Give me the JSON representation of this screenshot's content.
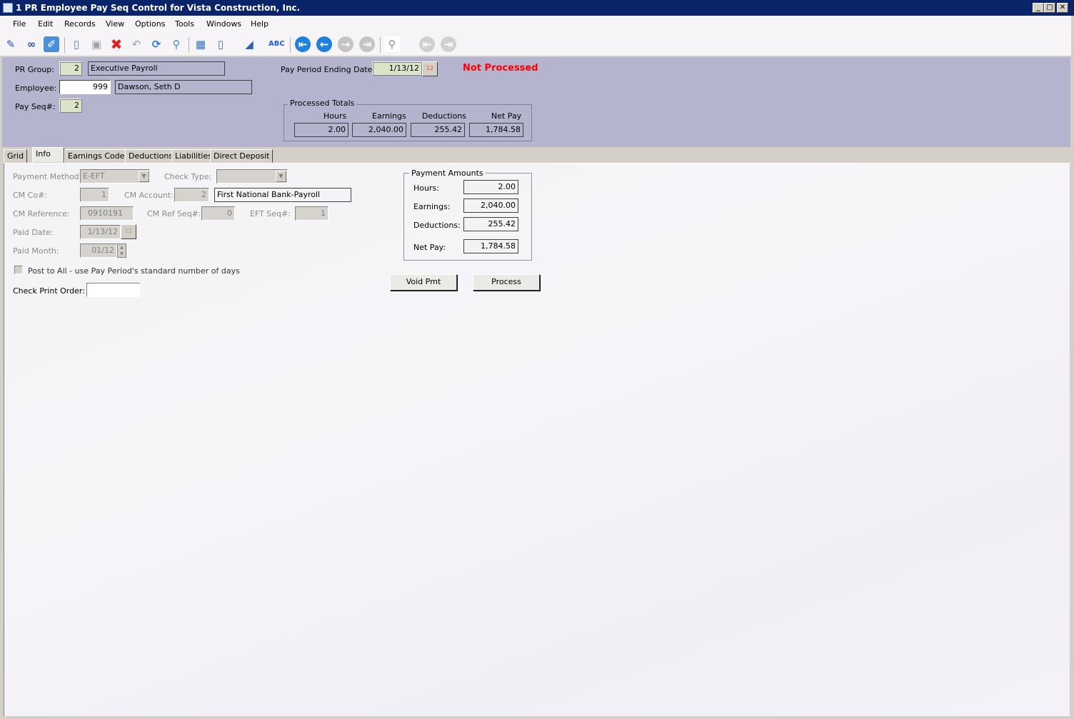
{
  "window": {
    "title": "1 PR Employee Pay Seq Control for Vista Construction, Inc.",
    "minimize": "_",
    "maximize": "□",
    "close": "✕"
  },
  "menu": [
    "File",
    "Edit",
    "Records",
    "View",
    "Options",
    "Tools",
    "Windows",
    "Help"
  ],
  "toolbar": {
    "icons": [
      "edit-icon",
      "find-icon",
      "clipboard-icon",
      "new-icon",
      "save-icon",
      "delete-icon",
      "undo-icon",
      "refresh-icon",
      "search-icon",
      "calculator-icon",
      "attach-icon",
      "scan-icon",
      "spellcheck-icon",
      "first-record-icon",
      "previous-record-icon",
      "next-record-icon",
      "last-record-icon",
      "report-icon",
      "first-icon",
      "last-icon"
    ]
  },
  "header": {
    "pr_group_label": "PR Group:",
    "pr_group": "2",
    "pr_group_name": "Executive Payroll",
    "employee_label": "Employee:",
    "employee": "999",
    "employee_name": "Dawson, Seth D",
    "pay_seq_label": "Pay Seq#:",
    "pay_seq": "2",
    "pay_period_label": "Pay Period Ending Date:",
    "pay_period": "1/13/12",
    "status": "Not Processed",
    "status_color": "#ff0000",
    "totals": {
      "title": "Processed Totals",
      "hours_label": "Hours",
      "earnings_label": "Earnings",
      "deductions_label": "Deductions",
      "netpay_label": "Net Pay",
      "hours": "2.00",
      "earnings": "2,040.00",
      "deductions": "255.42",
      "netpay": "1,784.58"
    }
  },
  "tabs": [
    "Grid",
    "Info",
    "Earnings Codes",
    "Deductions",
    "Liabilities",
    "Direct Deposit"
  ],
  "active_tab": "Info",
  "info": {
    "payment_method_label": "Payment Method:",
    "payment_method": "E-EFT",
    "check_type_label": "Check Type:",
    "check_type": "",
    "cm_co_label": "CM Co#:",
    "cm_co": "1",
    "cm_account_label": "CM Account:",
    "cm_account": "2",
    "cm_account_name": "First National Bank-Payroll",
    "cm_reference_label": "CM Reference:",
    "cm_reference": "0910191",
    "cm_ref_seq_label": "CM Ref Seq#:",
    "cm_ref_seq": "0",
    "eft_seq_label": "EFT Seq#:",
    "eft_seq": "1",
    "paid_date_label": "Paid Date:",
    "paid_date": "1/13/12",
    "paid_month_label": "Paid Month:",
    "paid_month": "01/12",
    "post_to_all_label": "Post to All - use Pay Period's standard number of days",
    "post_to_all": false,
    "check_print_order_label": "Check Print Order:",
    "check_print_order": ""
  },
  "payment_amounts": {
    "title": "Payment Amounts",
    "hours_label": "Hours:",
    "hours": "2.00",
    "earnings_label": "Earnings:",
    "earnings": "2,040.00",
    "deductions_label": "Deductions:",
    "deductions": "255.42",
    "netpay_label": "Net Pay:",
    "netpay": "1,784.58"
  },
  "buttons": {
    "void": "Void Pmt",
    "process": "Process"
  }
}
